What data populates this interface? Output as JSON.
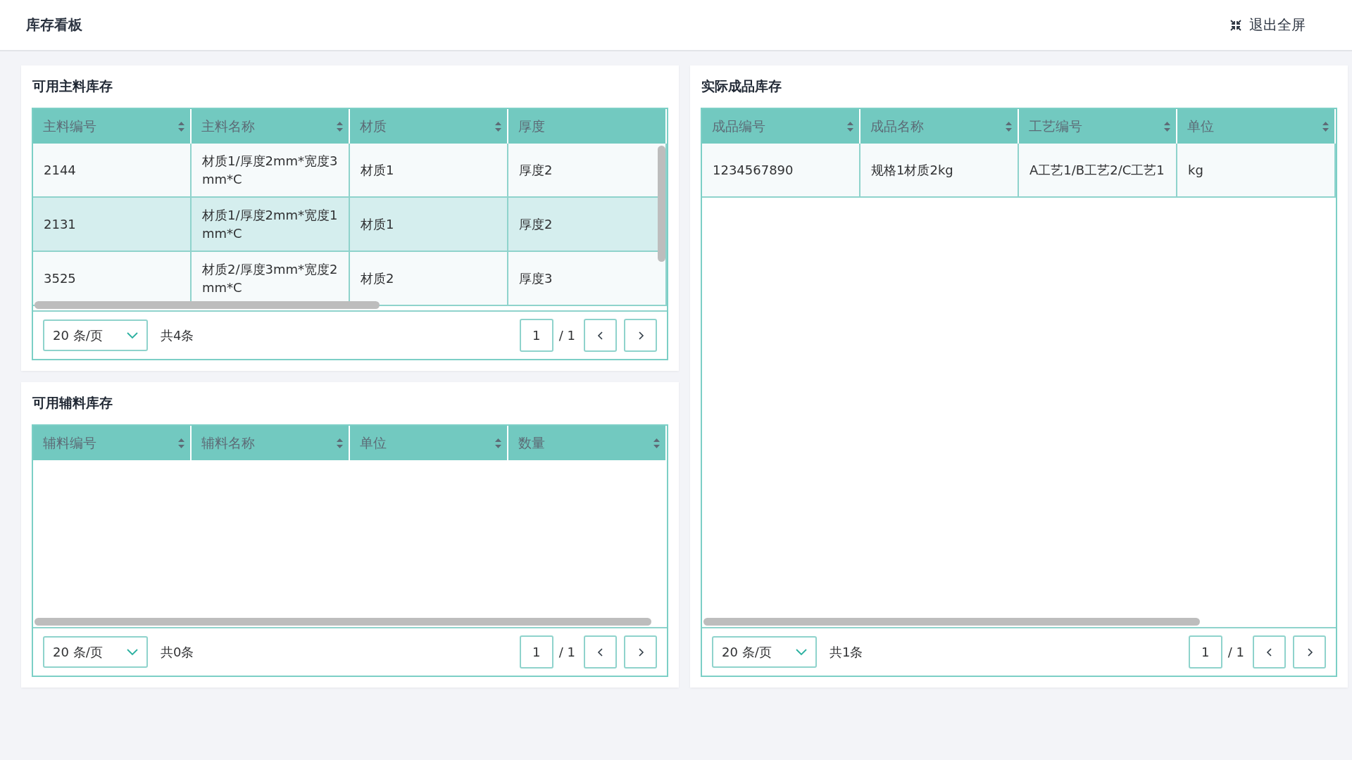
{
  "header": {
    "title": "库存看板",
    "exit_fullscreen": "退出全屏"
  },
  "main_stock": {
    "title": "可用主料库存",
    "columns": [
      {
        "label": "主料编号",
        "sortable": true
      },
      {
        "label": "主料名称",
        "sortable": true
      },
      {
        "label": "材质",
        "sortable": true
      },
      {
        "label": "厚度",
        "sortable": false
      }
    ],
    "rows": [
      {
        "cells": [
          "2144",
          "材质1/厚度2mm*宽度3mm*C",
          "材质1",
          "厚度2"
        ],
        "selected": false
      },
      {
        "cells": [
          "2131",
          "材质1/厚度2mm*宽度1mm*C",
          "材质1",
          "厚度2"
        ],
        "selected": true
      },
      {
        "cells": [
          "3525",
          "材质2/厚度3mm*宽度2mm*C",
          "材质2",
          "厚度3"
        ],
        "selected": false
      }
    ],
    "pagination": {
      "page_size": "20 条/页",
      "total": "共4条",
      "page": "1",
      "pages": "/ 1"
    }
  },
  "finished_stock": {
    "title": "实际成品库存",
    "columns": [
      {
        "label": "成品编号",
        "sortable": true
      },
      {
        "label": "成品名称",
        "sortable": true
      },
      {
        "label": "工艺编号",
        "sortable": true
      },
      {
        "label": "单位",
        "sortable": true
      }
    ],
    "rows": [
      {
        "cells": [
          "1234567890",
          "规格1材质2kg",
          "A工艺1/B工艺2/C工艺1",
          "kg"
        ],
        "selected": false
      }
    ],
    "pagination": {
      "page_size": "20 条/页",
      "total": "共1条",
      "page": "1",
      "pages": "/ 1"
    }
  },
  "aux_stock": {
    "title": "可用辅料库存",
    "columns": [
      {
        "label": "辅料编号",
        "sortable": true
      },
      {
        "label": "辅料名称",
        "sortable": true
      },
      {
        "label": "单位",
        "sortable": true
      },
      {
        "label": "数量",
        "sortable": true
      }
    ],
    "pagination": {
      "page_size": "20 条/页",
      "total": "共0条",
      "page": "1",
      "pages": "/ 1"
    }
  }
}
